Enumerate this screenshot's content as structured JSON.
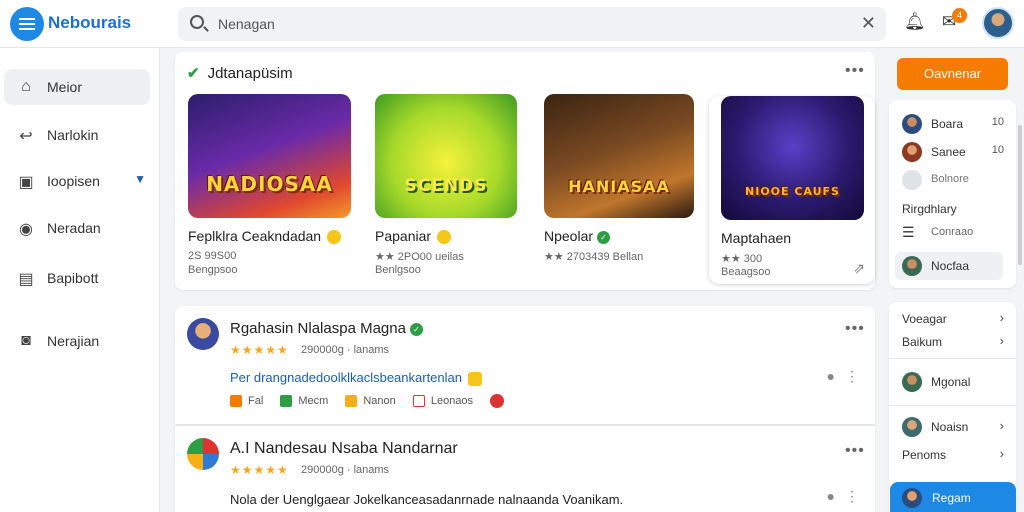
{
  "app": {
    "name": "Nebourais"
  },
  "search": {
    "value": "Nenagan"
  },
  "header": {
    "notif_count": "4"
  },
  "sidebar": {
    "items": [
      {
        "label": "Meior",
        "icon": "home-icon",
        "glyph": "⌂"
      },
      {
        "label": "Narlokin",
        "icon": "share-icon",
        "glyph": "↩"
      },
      {
        "label": "Ioopisen",
        "icon": "briefcase-icon",
        "glyph": "▣"
      },
      {
        "label": "Neradan",
        "icon": "location-pin-icon",
        "glyph": "◉"
      },
      {
        "label": "Bapibott",
        "icon": "chart-icon",
        "glyph": "▤"
      },
      {
        "label": "Nerajian",
        "icon": "lock-icon",
        "glyph": "◙"
      }
    ]
  },
  "featured": {
    "heading": "Jdtanapüsim",
    "games": [
      {
        "art": "NADIOSAA",
        "title": "Feplklra Ceakndadan",
        "meta1": "2S  99S00",
        "meta2": "Bengpsoo"
      },
      {
        "art": "SCENDS",
        "title": "Papaniar",
        "meta1": "★★ 2PO00   ueilas",
        "meta2": "Benlgsoo"
      },
      {
        "art": "HANIASAA",
        "title": "Npeolar",
        "meta1": "★★ 2703439  Bellan",
        "meta2": ""
      },
      {
        "art": "NIOOE CAUFS",
        "title": "Maptahaen",
        "meta1": "★★ 300",
        "meta2": "Beaagsoo"
      }
    ]
  },
  "posts": [
    {
      "name": "Rgahasin Nlalaspa Magna",
      "stars": "★★★★★",
      "meta": "290000g  ·  lanams",
      "text": "Per drangnadedoolklkaclsbeankartenlan",
      "actions": [
        "Fal",
        "Mecm",
        "Nanon",
        "Leonaos"
      ]
    },
    {
      "name": "A.I Nandesau Nsaba Nandarnar",
      "stars": "★★★★★",
      "meta": "290000g  ·  lanams",
      "text": "Nola der Uenglgaear  Jokelkanceasadanrnade  nalnaanda Voanikam."
    }
  ],
  "right": {
    "cta": "Oavnenar",
    "friends": [
      {
        "name": "Boara",
        "end": "10"
      },
      {
        "name": "Sanee",
        "end": "10"
      },
      {
        "name": "Bolnore",
        "end": ""
      }
    ],
    "section_title": "Rirgdhlary",
    "category": "Conraao",
    "active_friend": "Nocfaa",
    "links": [
      "Voeagar",
      "Baikum"
    ],
    "mini_users": [
      "Mgonal",
      "Noaisn",
      "Penoms"
    ],
    "footer_user": "Regam"
  }
}
